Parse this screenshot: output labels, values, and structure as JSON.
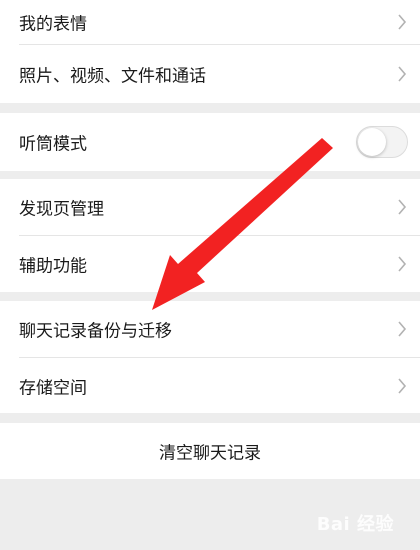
{
  "groups": {
    "g1": {
      "items": [
        {
          "label": "我的表情"
        },
        {
          "label": "照片、视频、文件和通话"
        }
      ]
    },
    "g2": {
      "items": [
        {
          "label": "听筒模式",
          "toggle_on": false
        }
      ]
    },
    "g3": {
      "items": [
        {
          "label": "发现页管理"
        },
        {
          "label": "辅助功能"
        }
      ]
    },
    "g4": {
      "items": [
        {
          "label": "聊天记录备份与迁移"
        },
        {
          "label": "存储空间"
        }
      ]
    },
    "g5": {
      "action_label": "清空聊天记录"
    }
  },
  "annotation": {
    "arrow_color": "#f22222",
    "icon": "arrow-annotation-icon"
  },
  "watermark": {
    "text": "Bai 经验"
  },
  "colors": {
    "page_bg": "#ededed",
    "group_bg": "#ffffff",
    "divider": "#e5e5e5",
    "text": "#1a1a1a",
    "chevron": "#b2b2b2"
  }
}
